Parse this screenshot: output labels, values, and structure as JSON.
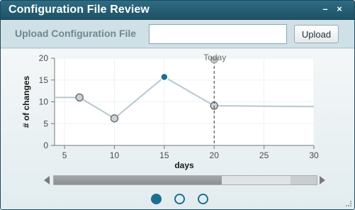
{
  "window": {
    "title": "Configuration File Review",
    "minimize_label": "–",
    "close_label": "×"
  },
  "upload": {
    "label": "Upload Configuration File",
    "input_value": "",
    "button_label": "Upload"
  },
  "pager": {
    "pages": 3,
    "active": 0
  },
  "chart_data": {
    "type": "line",
    "xlabel": "days",
    "ylabel": "# of changes",
    "xlim": [
      4,
      30
    ],
    "ylim": [
      0,
      20
    ],
    "x_ticks": [
      5,
      10,
      15,
      20,
      25,
      30
    ],
    "y_ticks": [
      0,
      5,
      10,
      15,
      20
    ],
    "grid": true,
    "series": [
      {
        "values": [
          {
            "x": 4,
            "y": 11
          },
          {
            "x": 6.5,
            "y": 11
          },
          {
            "x": 10,
            "y": 6.2
          },
          {
            "x": 15,
            "y": 15.7
          },
          {
            "x": 20,
            "y": 9.1
          },
          {
            "x": 30,
            "y": 8.9
          }
        ],
        "markers": [
          {
            "x": 6.5,
            "y": 11,
            "highlight": false
          },
          {
            "x": 10,
            "y": 6.2,
            "highlight": false
          },
          {
            "x": 15,
            "y": 15.7,
            "highlight": true
          },
          {
            "x": 20,
            "y": 9.1,
            "highlight": false
          }
        ],
        "color": "#b6c8cf"
      }
    ],
    "annotations": [
      {
        "type": "vline",
        "x": 20,
        "label": "Today"
      }
    ],
    "colors": {
      "line": "#b6c8cf",
      "marker_fill": "#d0d3d5",
      "marker_stroke": "#6d7275",
      "highlight": "#1b6f8f",
      "today_line": "#333333"
    }
  }
}
